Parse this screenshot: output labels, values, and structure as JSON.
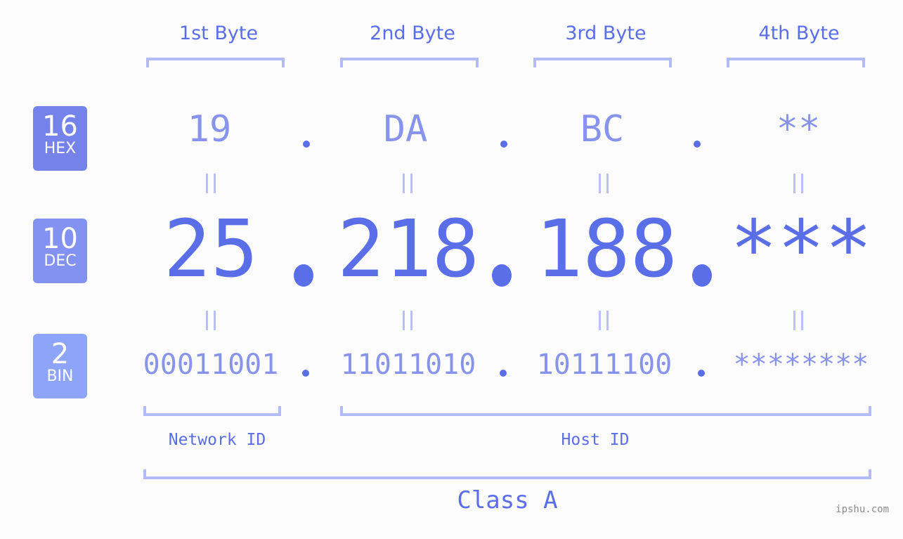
{
  "bytes": [
    {
      "label": "1st Byte",
      "hex": "19",
      "dec": "25",
      "bin": "00011001"
    },
    {
      "label": "2nd Byte",
      "hex": "DA",
      "dec": "218",
      "bin": "11011010"
    },
    {
      "label": "3rd Byte",
      "hex": "BC",
      "dec": "188",
      "bin": "10111100"
    },
    {
      "label": "4th Byte",
      "hex": "**",
      "dec": "***",
      "bin": "********"
    }
  ],
  "bases": [
    {
      "num": "16",
      "name": "HEX",
      "color": "#7582ea"
    },
    {
      "num": "10",
      "name": "DEC",
      "color": "#8391f0"
    },
    {
      "num": "2",
      "name": "BIN",
      "color": "#8da4f8"
    }
  ],
  "network_label": "Network ID",
  "host_label": "Host ID",
  "class_label": "Class A",
  "watermark": "ipshu.com"
}
